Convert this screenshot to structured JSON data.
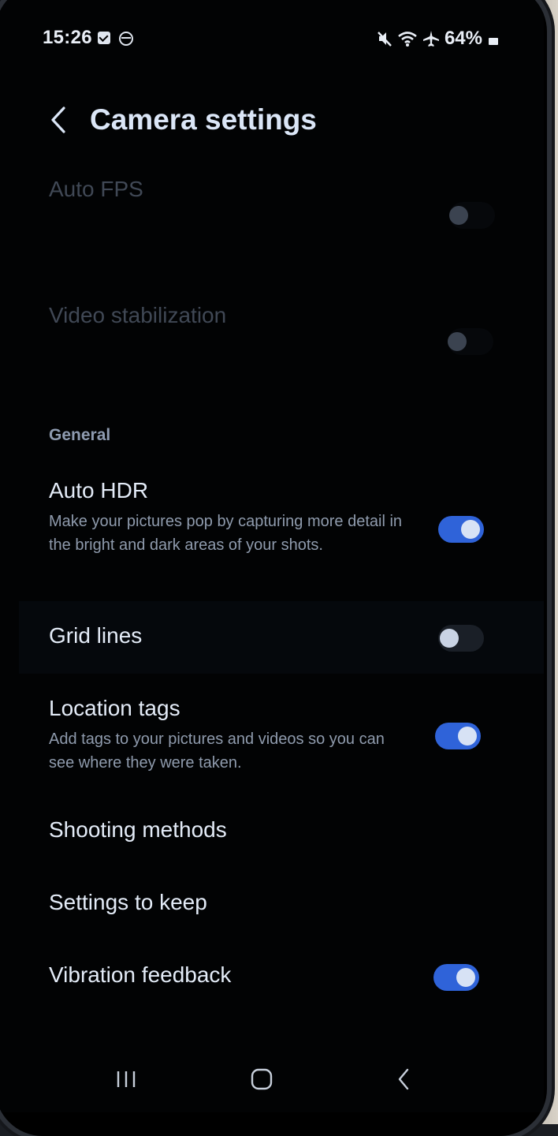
{
  "status_bar": {
    "time": "15:26",
    "battery": "64%",
    "icons": [
      "checkbox-notification-icon",
      "circle-notification-icon",
      "mute-icon",
      "wifi-icon",
      "airplane-icon",
      "battery-icon"
    ]
  },
  "header": {
    "title": "Camera settings",
    "back_icon": "chevron-left-icon"
  },
  "settings": {
    "auto_fps": {
      "title": "Auto FPS",
      "enabled": false
    },
    "video_stabilization": {
      "title": "Video stabilization",
      "enabled": false
    },
    "general_header": "General",
    "auto_hdr": {
      "title": "Auto HDR",
      "description": "Make your pictures pop by capturing more detail in the bright and dark areas of your shots.",
      "enabled": true
    },
    "grid_lines": {
      "title": "Grid lines",
      "enabled": false
    },
    "location_tags": {
      "title": "Location tags",
      "description": "Add tags to your pictures and videos so you can see where they were taken.",
      "enabled": true
    },
    "shooting_methods": {
      "title": "Shooting methods"
    },
    "settings_to_keep": {
      "title": "Settings to keep"
    },
    "vibration_feedback": {
      "title": "Vibration feedback",
      "enabled": true
    }
  },
  "nav_bar": {
    "recents_icon": "recents-icon",
    "home_icon": "home-icon",
    "back_icon": "back-icon"
  },
  "colors": {
    "background": "#020304",
    "accent": "#2f63d9",
    "title_text": "#dbe6f7",
    "secondary_text": "#8f9bad"
  }
}
